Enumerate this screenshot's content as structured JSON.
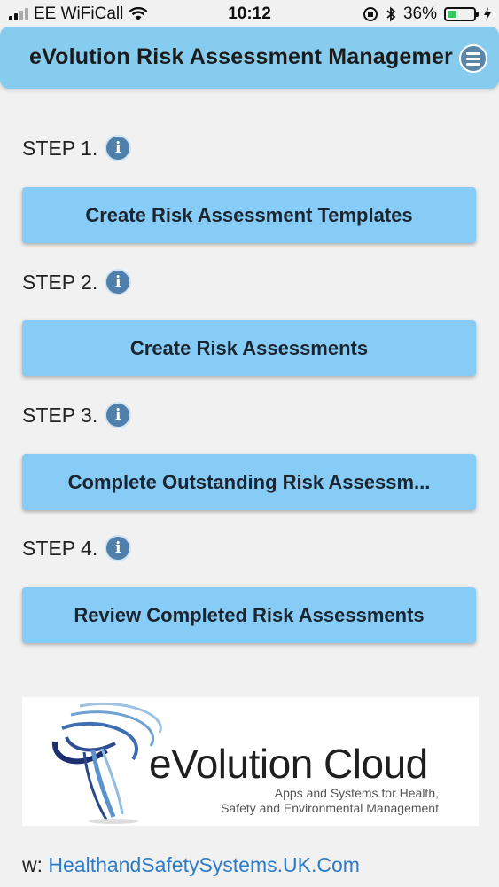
{
  "status_bar": {
    "carrier": "EE WiFiCall",
    "time": "10:12",
    "battery_percent": "36%",
    "battery_level": 0.36
  },
  "header": {
    "title": "eVolution Risk Assessment Managemer",
    "menu_icon": "hamburger-menu-icon"
  },
  "steps": [
    {
      "label": "STEP 1.",
      "button": "Create Risk Assessment Templates"
    },
    {
      "label": "STEP 2.",
      "button": "Create Risk Assessments"
    },
    {
      "label": "STEP 3.",
      "button": "Complete Outstanding Risk Assessm..."
    },
    {
      "label": "STEP 4.",
      "button": "Review Completed Risk Assessments"
    }
  ],
  "logo": {
    "name": "eVolution Cloud",
    "tagline_1": "Apps and Systems for Health,",
    "tagline_2": "Safety and Environmental Management"
  },
  "footer": {
    "prefix": "w:",
    "link": "HealthandSafetySystems.UK.Com"
  },
  "colors": {
    "header_bg": "#86ccef",
    "button_bg": "#86ccf6",
    "info_icon": "#4f7faa",
    "link": "#2c7bc9"
  }
}
